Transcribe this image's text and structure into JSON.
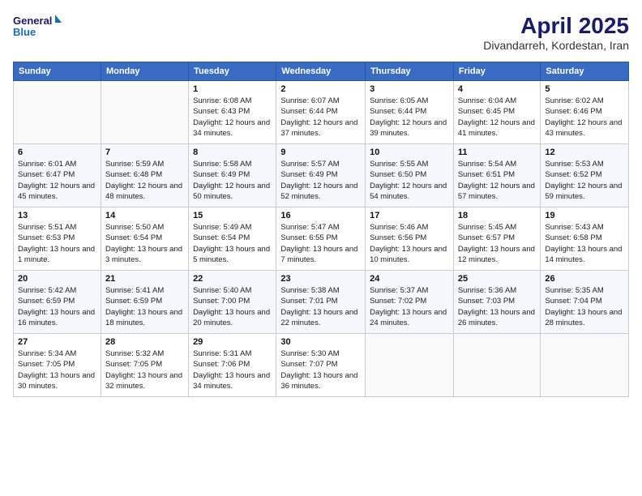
{
  "header": {
    "logo_line1": "General",
    "logo_line2": "Blue",
    "month_title": "April 2025",
    "location": "Divandarreh, Kordestan, Iran"
  },
  "days_of_week": [
    "Sunday",
    "Monday",
    "Tuesday",
    "Wednesday",
    "Thursday",
    "Friday",
    "Saturday"
  ],
  "weeks": [
    [
      {
        "day": "",
        "sunrise": "",
        "sunset": "",
        "daylight": ""
      },
      {
        "day": "",
        "sunrise": "",
        "sunset": "",
        "daylight": ""
      },
      {
        "day": "1",
        "sunrise": "Sunrise: 6:08 AM",
        "sunset": "Sunset: 6:43 PM",
        "daylight": "Daylight: 12 hours and 34 minutes."
      },
      {
        "day": "2",
        "sunrise": "Sunrise: 6:07 AM",
        "sunset": "Sunset: 6:44 PM",
        "daylight": "Daylight: 12 hours and 37 minutes."
      },
      {
        "day": "3",
        "sunrise": "Sunrise: 6:05 AM",
        "sunset": "Sunset: 6:44 PM",
        "daylight": "Daylight: 12 hours and 39 minutes."
      },
      {
        "day": "4",
        "sunrise": "Sunrise: 6:04 AM",
        "sunset": "Sunset: 6:45 PM",
        "daylight": "Daylight: 12 hours and 41 minutes."
      },
      {
        "day": "5",
        "sunrise": "Sunrise: 6:02 AM",
        "sunset": "Sunset: 6:46 PM",
        "daylight": "Daylight: 12 hours and 43 minutes."
      }
    ],
    [
      {
        "day": "6",
        "sunrise": "Sunrise: 6:01 AM",
        "sunset": "Sunset: 6:47 PM",
        "daylight": "Daylight: 12 hours and 45 minutes."
      },
      {
        "day": "7",
        "sunrise": "Sunrise: 5:59 AM",
        "sunset": "Sunset: 6:48 PM",
        "daylight": "Daylight: 12 hours and 48 minutes."
      },
      {
        "day": "8",
        "sunrise": "Sunrise: 5:58 AM",
        "sunset": "Sunset: 6:49 PM",
        "daylight": "Daylight: 12 hours and 50 minutes."
      },
      {
        "day": "9",
        "sunrise": "Sunrise: 5:57 AM",
        "sunset": "Sunset: 6:49 PM",
        "daylight": "Daylight: 12 hours and 52 minutes."
      },
      {
        "day": "10",
        "sunrise": "Sunrise: 5:55 AM",
        "sunset": "Sunset: 6:50 PM",
        "daylight": "Daylight: 12 hours and 54 minutes."
      },
      {
        "day": "11",
        "sunrise": "Sunrise: 5:54 AM",
        "sunset": "Sunset: 6:51 PM",
        "daylight": "Daylight: 12 hours and 57 minutes."
      },
      {
        "day": "12",
        "sunrise": "Sunrise: 5:53 AM",
        "sunset": "Sunset: 6:52 PM",
        "daylight": "Daylight: 12 hours and 59 minutes."
      }
    ],
    [
      {
        "day": "13",
        "sunrise": "Sunrise: 5:51 AM",
        "sunset": "Sunset: 6:53 PM",
        "daylight": "Daylight: 13 hours and 1 minute."
      },
      {
        "day": "14",
        "sunrise": "Sunrise: 5:50 AM",
        "sunset": "Sunset: 6:54 PM",
        "daylight": "Daylight: 13 hours and 3 minutes."
      },
      {
        "day": "15",
        "sunrise": "Sunrise: 5:49 AM",
        "sunset": "Sunset: 6:54 PM",
        "daylight": "Daylight: 13 hours and 5 minutes."
      },
      {
        "day": "16",
        "sunrise": "Sunrise: 5:47 AM",
        "sunset": "Sunset: 6:55 PM",
        "daylight": "Daylight: 13 hours and 7 minutes."
      },
      {
        "day": "17",
        "sunrise": "Sunrise: 5:46 AM",
        "sunset": "Sunset: 6:56 PM",
        "daylight": "Daylight: 13 hours and 10 minutes."
      },
      {
        "day": "18",
        "sunrise": "Sunrise: 5:45 AM",
        "sunset": "Sunset: 6:57 PM",
        "daylight": "Daylight: 13 hours and 12 minutes."
      },
      {
        "day": "19",
        "sunrise": "Sunrise: 5:43 AM",
        "sunset": "Sunset: 6:58 PM",
        "daylight": "Daylight: 13 hours and 14 minutes."
      }
    ],
    [
      {
        "day": "20",
        "sunrise": "Sunrise: 5:42 AM",
        "sunset": "Sunset: 6:59 PM",
        "daylight": "Daylight: 13 hours and 16 minutes."
      },
      {
        "day": "21",
        "sunrise": "Sunrise: 5:41 AM",
        "sunset": "Sunset: 6:59 PM",
        "daylight": "Daylight: 13 hours and 18 minutes."
      },
      {
        "day": "22",
        "sunrise": "Sunrise: 5:40 AM",
        "sunset": "Sunset: 7:00 PM",
        "daylight": "Daylight: 13 hours and 20 minutes."
      },
      {
        "day": "23",
        "sunrise": "Sunrise: 5:38 AM",
        "sunset": "Sunset: 7:01 PM",
        "daylight": "Daylight: 13 hours and 22 minutes."
      },
      {
        "day": "24",
        "sunrise": "Sunrise: 5:37 AM",
        "sunset": "Sunset: 7:02 PM",
        "daylight": "Daylight: 13 hours and 24 minutes."
      },
      {
        "day": "25",
        "sunrise": "Sunrise: 5:36 AM",
        "sunset": "Sunset: 7:03 PM",
        "daylight": "Daylight: 13 hours and 26 minutes."
      },
      {
        "day": "26",
        "sunrise": "Sunrise: 5:35 AM",
        "sunset": "Sunset: 7:04 PM",
        "daylight": "Daylight: 13 hours and 28 minutes."
      }
    ],
    [
      {
        "day": "27",
        "sunrise": "Sunrise: 5:34 AM",
        "sunset": "Sunset: 7:05 PM",
        "daylight": "Daylight: 13 hours and 30 minutes."
      },
      {
        "day": "28",
        "sunrise": "Sunrise: 5:32 AM",
        "sunset": "Sunset: 7:05 PM",
        "daylight": "Daylight: 13 hours and 32 minutes."
      },
      {
        "day": "29",
        "sunrise": "Sunrise: 5:31 AM",
        "sunset": "Sunset: 7:06 PM",
        "daylight": "Daylight: 13 hours and 34 minutes."
      },
      {
        "day": "30",
        "sunrise": "Sunrise: 5:30 AM",
        "sunset": "Sunset: 7:07 PM",
        "daylight": "Daylight: 13 hours and 36 minutes."
      },
      {
        "day": "",
        "sunrise": "",
        "sunset": "",
        "daylight": ""
      },
      {
        "day": "",
        "sunrise": "",
        "sunset": "",
        "daylight": ""
      },
      {
        "day": "",
        "sunrise": "",
        "sunset": "",
        "daylight": ""
      }
    ]
  ]
}
